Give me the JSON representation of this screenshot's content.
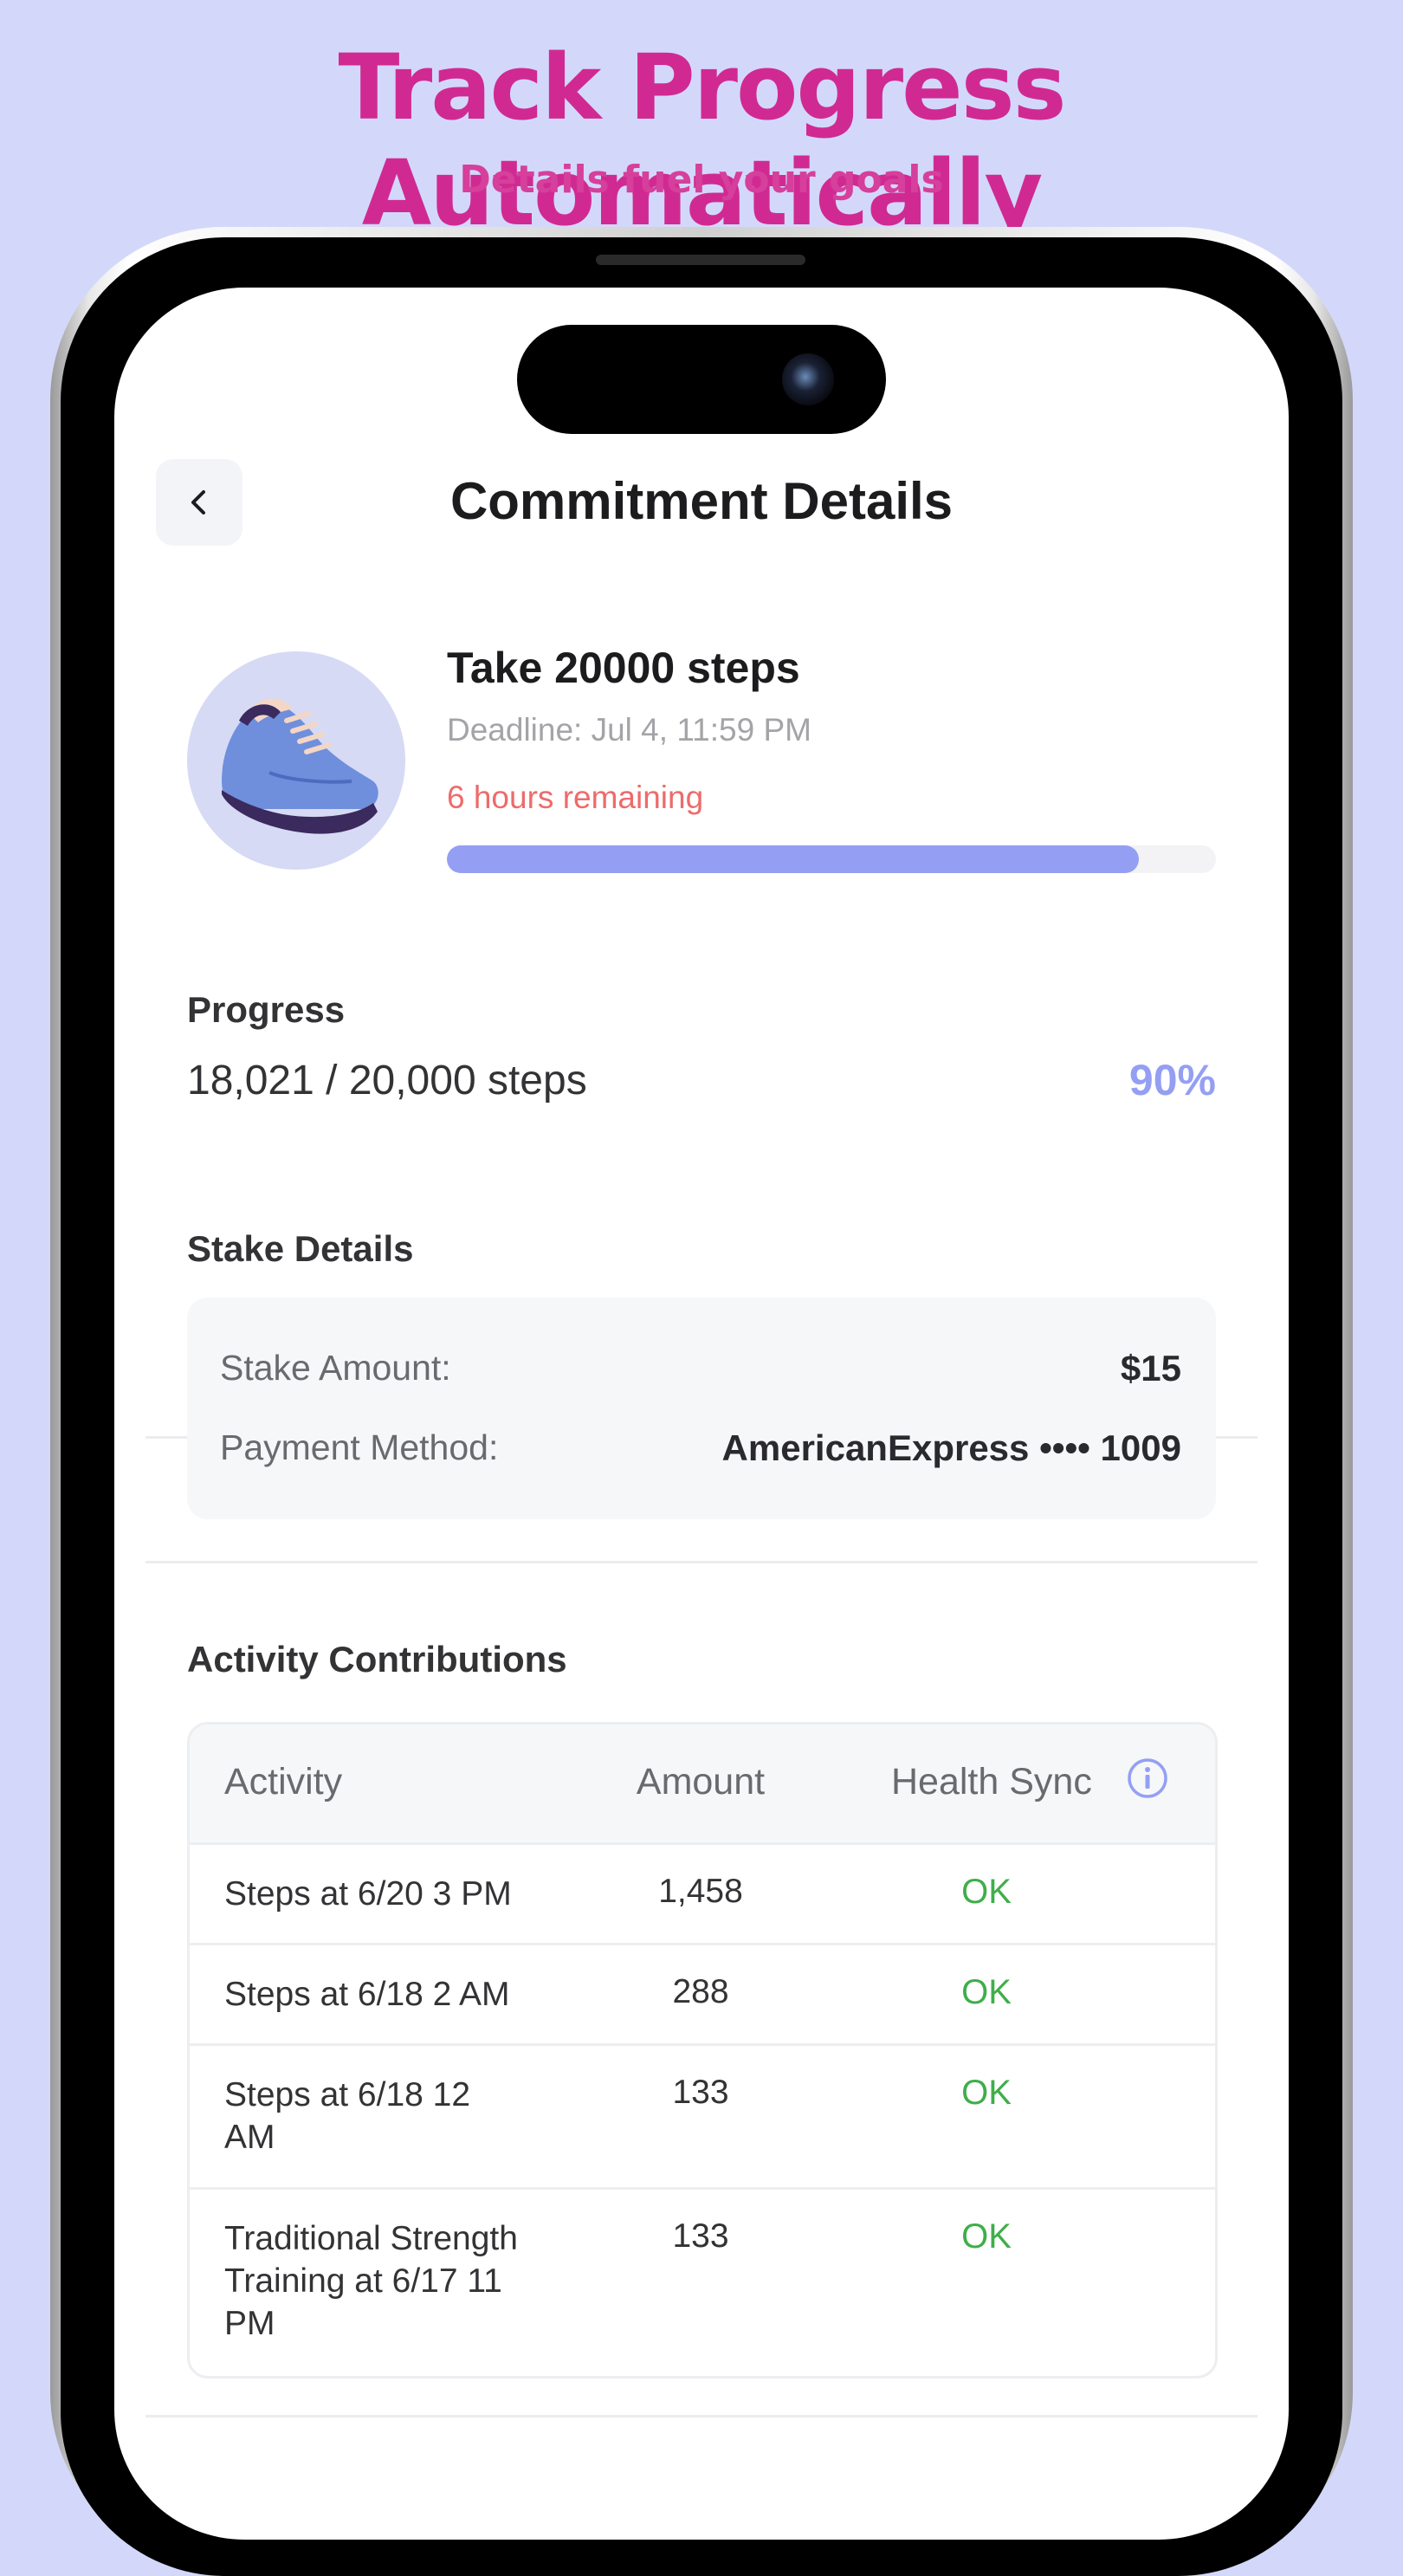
{
  "promo": {
    "headline": "Track Progress Automatically",
    "subheadline": "Details fuel your goals"
  },
  "nav": {
    "title": "Commitment Details"
  },
  "commitment": {
    "title": "Take 20000 steps",
    "deadline": "Deadline: Jul 4, 11:59 PM",
    "remaining": "6 hours remaining",
    "progress_fraction": 0.9,
    "icon": "sneaker-icon"
  },
  "progress": {
    "label": "Progress",
    "steps": "18,021 / 20,000 steps",
    "percent": "90%"
  },
  "stake": {
    "label": "Stake Details",
    "amount_label": "Stake Amount:",
    "amount_value": "$15",
    "payment_label": "Payment Method:",
    "payment_value": "AmericanExpress •••• 1009"
  },
  "activity": {
    "label": "Activity Contributions",
    "headers": [
      "Activity",
      "Amount",
      "Health Sync"
    ],
    "rows": [
      {
        "activity": "Steps at 6/20 3 PM",
        "amount": "1,458",
        "sync": "OK"
      },
      {
        "activity": "Steps at 6/18 2 AM",
        "amount": "288",
        "sync": "OK"
      },
      {
        "activity": "Steps at 6/18 12 AM",
        "amount": "133",
        "sync": "OK"
      },
      {
        "activity": "Traditional Strength Training at 6/17 11 PM",
        "amount": "133",
        "sync": "OK"
      }
    ]
  },
  "colors": {
    "accent": "#949ff4",
    "headline": "#d02a92",
    "warning": "#ee6b6b",
    "success": "#3fae4a",
    "background": "#d3d8fb"
  }
}
